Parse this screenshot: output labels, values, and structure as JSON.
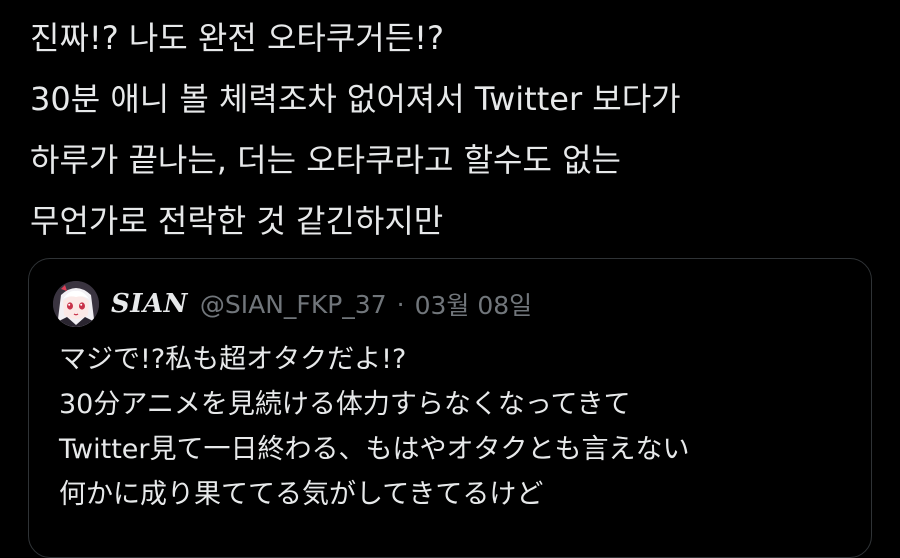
{
  "tweet": {
    "lines": [
      "진짜!? 나도 완전 오타쿠거든!?",
      "30분 애니 볼 체력조차 없어져서 Twitter 보다가",
      "하루가 끝나는, 더는 오타쿠라고 할수도 없는",
      "무언가로 전락한 것 같긴하지만"
    ]
  },
  "quote": {
    "display_name": "SIAN",
    "handle": "@SIAN_FKP_37",
    "separator": "·",
    "date": "03월 08일",
    "avatar_icon": "anime-character-avatar-icon",
    "lines": [
      "マジで!?私も超オタクだよ!?",
      "30分アニメを見続ける体力すらなくなってきて",
      "Twitter見て一日終わる、もはやオタクとも言えない",
      "何かに成り果ててる気がしてきてるけど"
    ]
  },
  "colors": {
    "background": "#000000",
    "text": "#e7e9ea",
    "secondary_text": "#71767b",
    "card_border": "#2f3336"
  }
}
